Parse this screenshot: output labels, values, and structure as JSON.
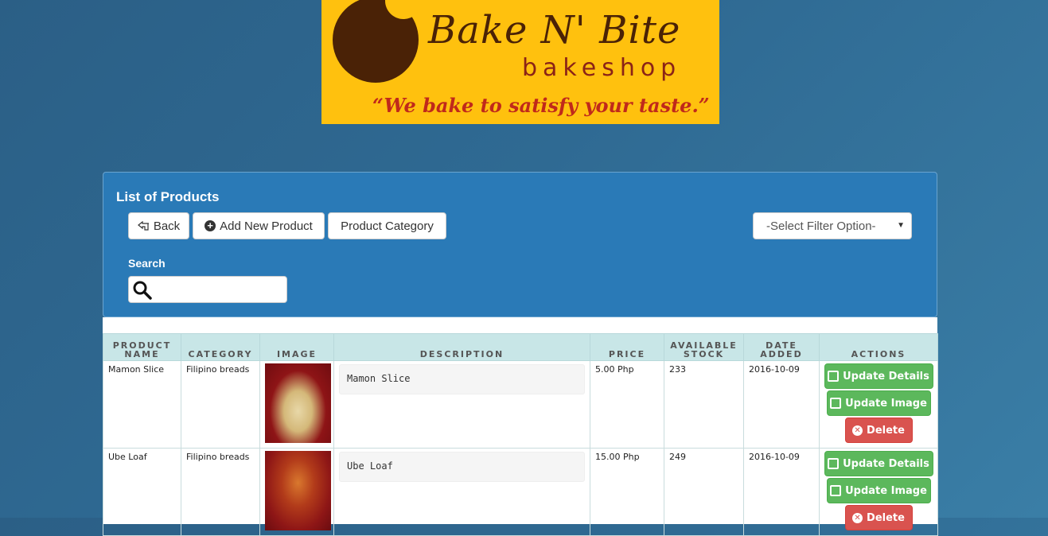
{
  "logo": {
    "brand": "Bake N' Bite",
    "sub": "bakeshop",
    "tagline": "“We bake to satisfy your taste.”"
  },
  "panel": {
    "title": "List of Products",
    "buttons": {
      "back": "Back",
      "add": "Add New Product",
      "category": "Product Category"
    },
    "filter": {
      "selected": "-Select Filter Option-"
    },
    "search_label": "Search",
    "search_value": ""
  },
  "table": {
    "headers": {
      "name": "PRODUCT NAME",
      "category": "CATEGORY",
      "image": "IMAGE",
      "description": "DESCRIPTION",
      "price": "PRICE",
      "stock": "AVAILABLE STOCK",
      "date": "DATE ADDED",
      "actions": "ACTIONS"
    },
    "rows": [
      {
        "name": "Mamon Slice",
        "category": "Filipino breads",
        "description": "Mamon Slice",
        "price": "5.00 Php",
        "stock": "233",
        "date": "2016-10-09"
      },
      {
        "name": "Ube Loaf",
        "category": "Filipino breads",
        "description": "Ube Loaf",
        "price": "15.00 Php",
        "stock": "249",
        "date": "2016-10-09"
      }
    ],
    "action_labels": {
      "update_details": "Update Details",
      "update_image": "Update Image",
      "delete": "Delete"
    }
  },
  "colors": {
    "panel": "#2a7ab7",
    "header_bg": "#c8e6e7",
    "success": "#5cb85c",
    "danger": "#d9534f",
    "logo_bg": "#ffc10e"
  }
}
